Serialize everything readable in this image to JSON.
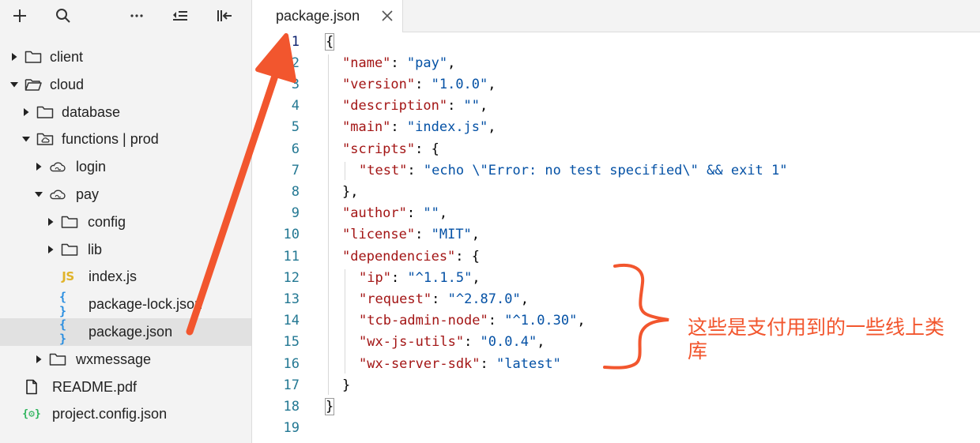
{
  "toolbar": {
    "icons": [
      "plus-icon",
      "search-icon",
      "more-icon",
      "collapse-list-icon",
      "toggle-panel-icon"
    ]
  },
  "tree": [
    {
      "name": "client",
      "type": "folder",
      "depth": 0,
      "expanded": false
    },
    {
      "name": "cloud",
      "type": "folder",
      "depth": 0,
      "expanded": true
    },
    {
      "name": "database",
      "type": "folder",
      "depth": 1,
      "expanded": false
    },
    {
      "name": "functions | prod",
      "type": "cloud-folder",
      "depth": 1,
      "expanded": true
    },
    {
      "name": "login",
      "type": "cloud-function",
      "depth": 2,
      "expanded": false
    },
    {
      "name": "pay",
      "type": "cloud-function",
      "depth": 2,
      "expanded": true
    },
    {
      "name": "config",
      "type": "folder",
      "depth": 3,
      "expanded": false
    },
    {
      "name": "lib",
      "type": "folder",
      "depth": 3,
      "expanded": false
    },
    {
      "name": "index.js",
      "type": "js",
      "depth": 3
    },
    {
      "name": "package-lock.json",
      "type": "json",
      "depth": 3
    },
    {
      "name": "package.json",
      "type": "json",
      "depth": 3,
      "selected": true
    },
    {
      "name": "wxmessage",
      "type": "folder",
      "depth": 2,
      "expanded": false
    },
    {
      "name": "README.pdf",
      "type": "file",
      "depth": 0
    },
    {
      "name": "project.config.json",
      "type": "config",
      "depth": 0
    }
  ],
  "badges": {
    "js": "JS",
    "json": "{ }",
    "config": "{⚙}"
  },
  "tab": {
    "label": "package.json",
    "close": "×"
  },
  "editor": {
    "active_line": 1,
    "lines": [
      [
        {
          "t": "p",
          "v": "{"
        }
      ],
      [
        {
          "t": "k",
          "v": "\"name\""
        },
        {
          "t": "p",
          "v": ": "
        },
        {
          "t": "s",
          "v": "\"pay\""
        },
        {
          "t": "p",
          "v": ","
        }
      ],
      [
        {
          "t": "k",
          "v": "\"version\""
        },
        {
          "t": "p",
          "v": ": "
        },
        {
          "t": "s",
          "v": "\"1.0.0\""
        },
        {
          "t": "p",
          "v": ","
        }
      ],
      [
        {
          "t": "k",
          "v": "\"description\""
        },
        {
          "t": "p",
          "v": ": "
        },
        {
          "t": "s",
          "v": "\"\""
        },
        {
          "t": "p",
          "v": ","
        }
      ],
      [
        {
          "t": "k",
          "v": "\"main\""
        },
        {
          "t": "p",
          "v": ": "
        },
        {
          "t": "s",
          "v": "\"index.js\""
        },
        {
          "t": "p",
          "v": ","
        }
      ],
      [
        {
          "t": "k",
          "v": "\"scripts\""
        },
        {
          "t": "p",
          "v": ": {"
        }
      ],
      [
        {
          "t": "k",
          "v": "\"test\""
        },
        {
          "t": "p",
          "v": ": "
        },
        {
          "t": "s",
          "v": "\"echo \\\"Error: no test specified\\\" && exit 1\""
        }
      ],
      [
        {
          "t": "p",
          "v": "},"
        }
      ],
      [
        {
          "t": "k",
          "v": "\"author\""
        },
        {
          "t": "p",
          "v": ": "
        },
        {
          "t": "s",
          "v": "\"\""
        },
        {
          "t": "p",
          "v": ","
        }
      ],
      [
        {
          "t": "k",
          "v": "\"license\""
        },
        {
          "t": "p",
          "v": ": "
        },
        {
          "t": "s",
          "v": "\"MIT\""
        },
        {
          "t": "p",
          "v": ","
        }
      ],
      [
        {
          "t": "k",
          "v": "\"dependencies\""
        },
        {
          "t": "p",
          "v": ": {"
        }
      ],
      [
        {
          "t": "k",
          "v": "\"ip\""
        },
        {
          "t": "p",
          "v": ": "
        },
        {
          "t": "s",
          "v": "\"^1.1.5\""
        },
        {
          "t": "p",
          "v": ","
        }
      ],
      [
        {
          "t": "k",
          "v": "\"request\""
        },
        {
          "t": "p",
          "v": ": "
        },
        {
          "t": "s",
          "v": "\"^2.87.0\""
        },
        {
          "t": "p",
          "v": ","
        }
      ],
      [
        {
          "t": "k",
          "v": "\"tcb-admin-node\""
        },
        {
          "t": "p",
          "v": ": "
        },
        {
          "t": "s",
          "v": "\"^1.0.30\""
        },
        {
          "t": "p",
          "v": ","
        }
      ],
      [
        {
          "t": "k",
          "v": "\"wx-js-utils\""
        },
        {
          "t": "p",
          "v": ": "
        },
        {
          "t": "s",
          "v": "\"0.0.4\""
        },
        {
          "t": "p",
          "v": ","
        }
      ],
      [
        {
          "t": "k",
          "v": "\"wx-server-sdk\""
        },
        {
          "t": "p",
          "v": ": "
        },
        {
          "t": "s",
          "v": "\"latest\""
        }
      ],
      [
        {
          "t": "p",
          "v": "}"
        }
      ],
      [
        {
          "t": "p",
          "v": "}"
        }
      ],
      []
    ],
    "indent": [
      0,
      1,
      1,
      1,
      1,
      1,
      2,
      1,
      1,
      1,
      1,
      2,
      2,
      2,
      2,
      2,
      1,
      0,
      0
    ]
  },
  "annotation": {
    "text": "这些是支付用到的一些线上类库",
    "color": "#f2562e"
  },
  "colors": {
    "sidebar_bg": "#f3f3f3",
    "selected_row": "#e1e1e1",
    "line_number": "#237893",
    "key": "#a31515",
    "string": "#0451a5"
  }
}
